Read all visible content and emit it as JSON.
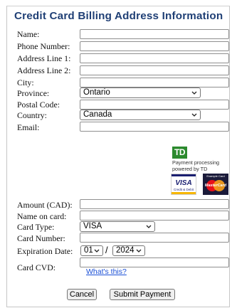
{
  "title": "Credit Card Billing Address Information",
  "address": {
    "name_label": "Name:",
    "name_value": "",
    "phone_label": "Phone Number:",
    "phone_value": "",
    "address1_label": "Address Line 1:",
    "address1_value": "",
    "address2_label": "Address Line 2:",
    "address2_value": "",
    "city_label": "City:",
    "city_value": "",
    "province_label": "Province:",
    "province_selected": "Ontario",
    "postal_label": "Postal Code:",
    "postal_value": "",
    "country_label": "Country:",
    "country_selected": "Canada",
    "email_label": "Email:",
    "email_value": ""
  },
  "processor": {
    "logo_text": "TD",
    "caption_line1": "Payment processing",
    "caption_line2": "powered by TD",
    "visa_text": "VISA",
    "visa_sub": "Credit & Debit",
    "mastercard_top": "Example Card",
    "mastercard_text": "MasterCard",
    "brand_green": "#2c8a2e"
  },
  "payment": {
    "amount_label": "Amount (CAD):",
    "amount_value": "",
    "name_on_card_label": "Name on card:",
    "name_on_card_value": "",
    "card_type_label": "Card Type:",
    "card_type_selected": "VISA",
    "card_number_label": "Card Number:",
    "card_number_value": "",
    "expiration_label": "Expiration Date:",
    "exp_month_selected": "01",
    "exp_separator": "/",
    "exp_year_selected": "2024",
    "cvd_label": "Card CVD:",
    "cvd_value": "",
    "whats_this_link": "What's this?"
  },
  "buttons": {
    "cancel": "Cancel",
    "submit": "Submit Payment"
  },
  "colors": {
    "title": "#1f3f75",
    "link": "#1a4fd6"
  }
}
